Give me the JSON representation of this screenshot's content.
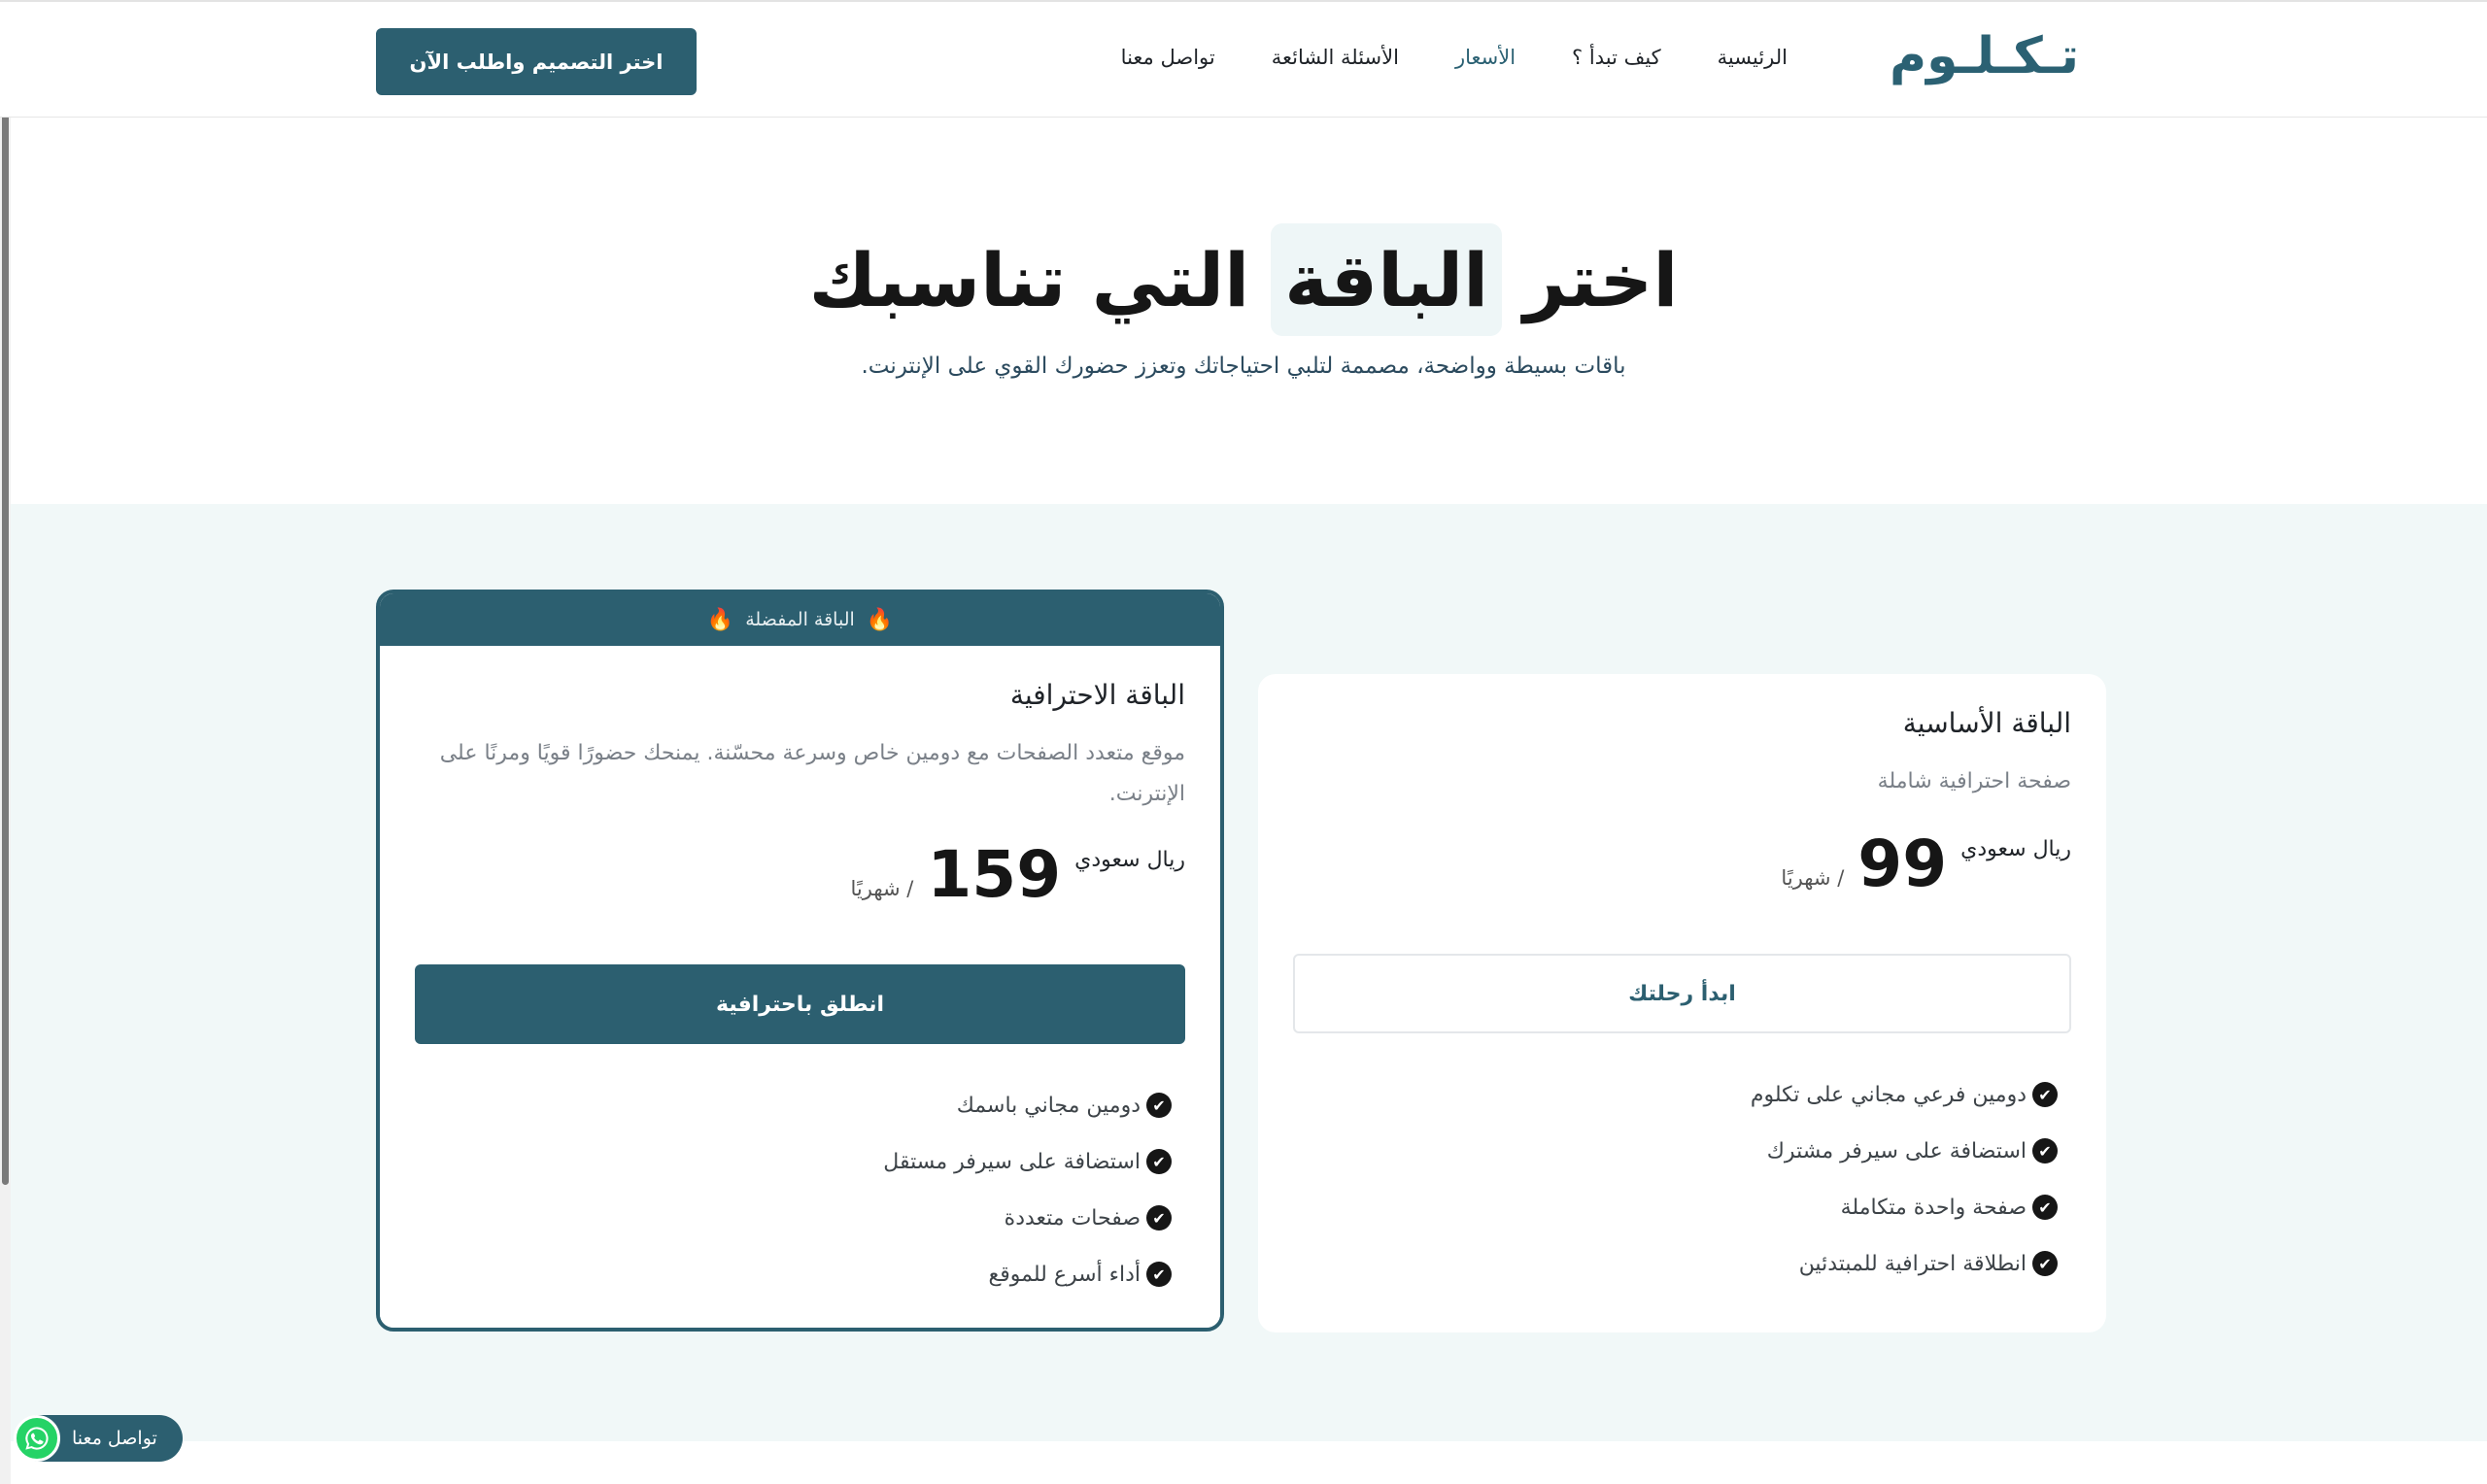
{
  "header": {
    "logo": "تـكـلـوم",
    "nav": [
      {
        "label": "الرئيسية",
        "active": false
      },
      {
        "label": "كيف تبدأ ؟",
        "active": false
      },
      {
        "label": "الأسعار",
        "active": true
      },
      {
        "label": "الأسئلة الشائعة",
        "active": false
      },
      {
        "label": "تواصل معنا",
        "active": false
      }
    ],
    "cta_label": "اختر التصميم واطلب الآن"
  },
  "hero": {
    "title_start": "اختر",
    "title_highlight": "الباقة",
    "title_end": "التي تناسبك",
    "subtitle": "باقات بسيطة وواضحة، مصممة لتلبي احتياجاتك وتعزز حضورك القوي على الإنترنت."
  },
  "plans": {
    "basic": {
      "name": "الباقة الأساسية",
      "description": "صفحة احترافية شاملة",
      "currency": "ريال سعودي",
      "price": "99",
      "period": "/ شهريًا",
      "button": "ابدأ رحلتك",
      "features": [
        "دومين فرعي مجاني على تكلوم",
        "استضافة على سيرفر مشترك",
        "صفحة واحدة متكاملة",
        "انطلاقة احترافية للمبتدئين"
      ]
    },
    "pro": {
      "badge": "الباقة المفضلة",
      "name": "الباقة الاحترافية",
      "description": "موقع متعدد الصفحات مع دومين خاص وسرعة محسّنة. يمنحك حضورًا قويًا ومرنًا على الإنترنت.",
      "currency": "ريال سعودي",
      "price": "159",
      "period": "/ شهريًا",
      "button": "انطلق باحترافية",
      "features": [
        "دومين مجاني باسمك",
        "استضافة على سيرفر مستقل",
        "صفحات متعددة",
        "أداء أسرع للموقع"
      ]
    }
  },
  "whatsapp": {
    "label": "تواصل معنا"
  },
  "colors": {
    "brand": "#2c5f70",
    "section_bg": "#f1f8f8",
    "whatsapp": "#25d366"
  },
  "icons": [
    "check-icon",
    "fire-icon",
    "whatsapp-icon"
  ]
}
